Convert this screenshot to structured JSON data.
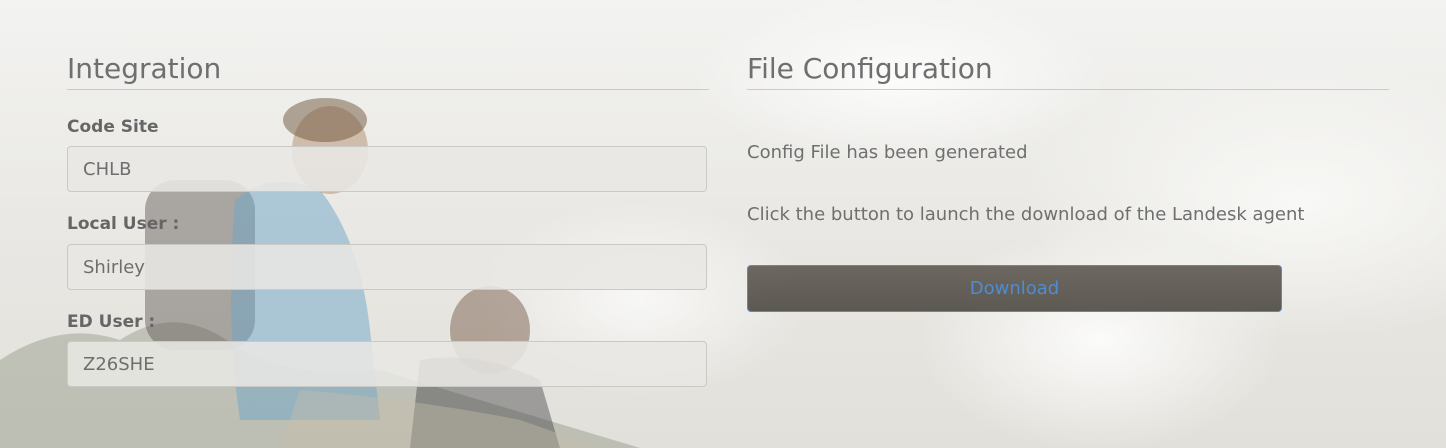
{
  "integration": {
    "title": "Integration",
    "fields": [
      {
        "label": "Code Site",
        "value": "CHLB"
      },
      {
        "label": "Local User :",
        "value": "Shirley"
      },
      {
        "label": "ED User :",
        "value": "Z26SHE"
      }
    ]
  },
  "file_configuration": {
    "title": "File Configuration",
    "status_text": "Config File has been generated",
    "instruction_text": "Click the button to launch the download of the Landesk agent",
    "download_label": "Download"
  },
  "colors": {
    "button_text": "#4d8dd3",
    "button_border": "#5b86c9",
    "heading": "#6f6f6f"
  }
}
